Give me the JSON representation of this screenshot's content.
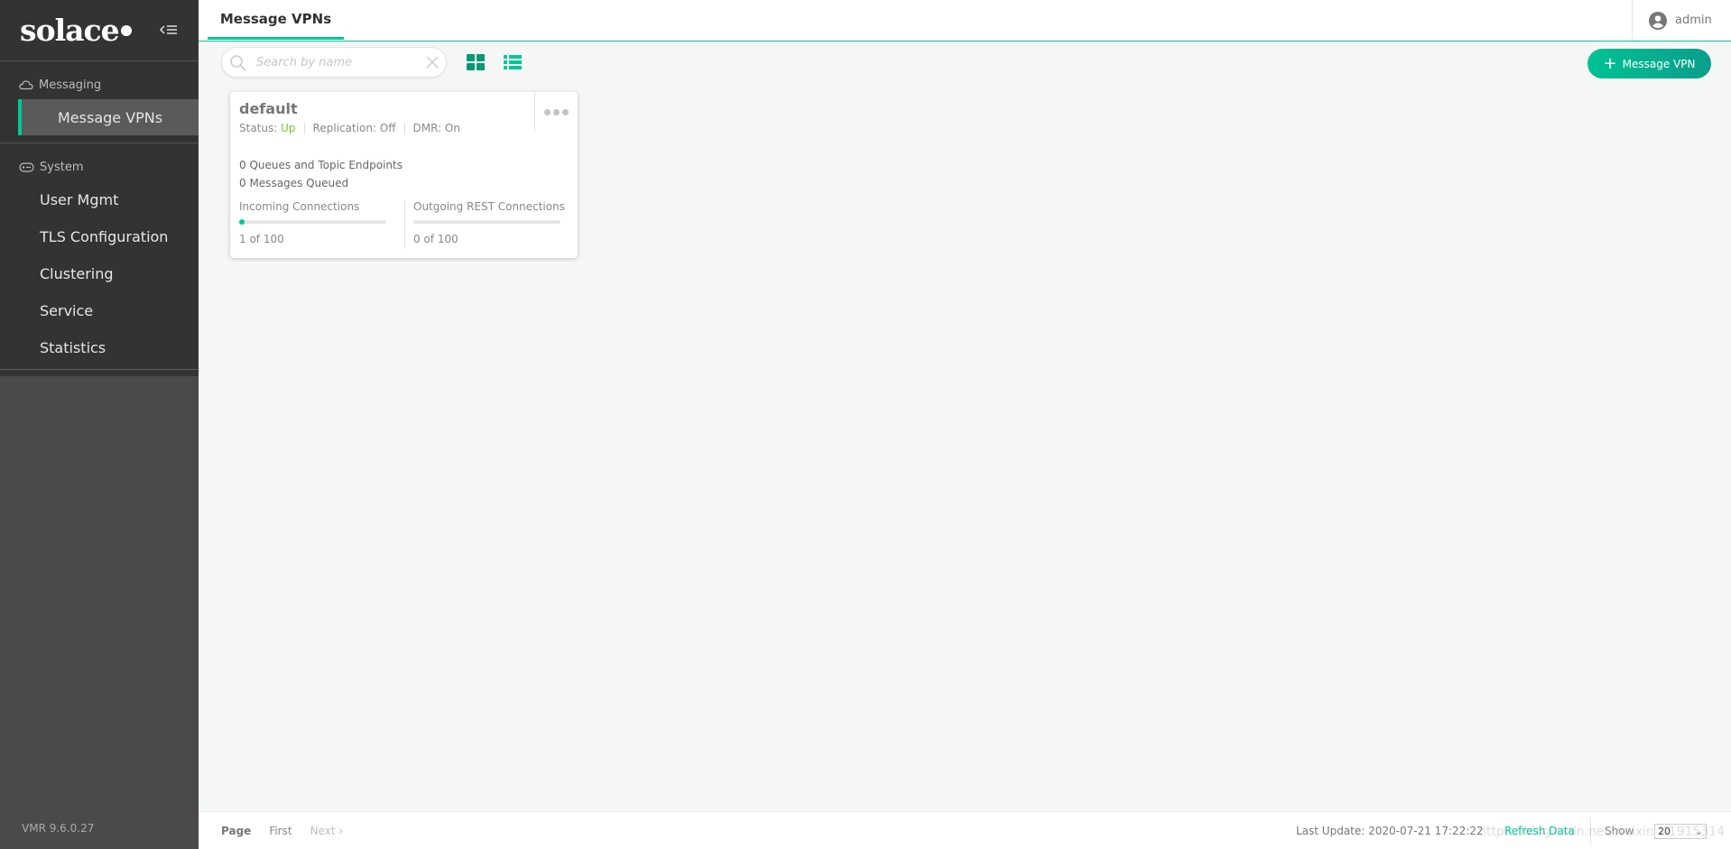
{
  "sidebar": {
    "logo": "solace",
    "sections": [
      {
        "label": "Messaging",
        "icon": "cloud-icon"
      },
      {
        "label": "System",
        "icon": "system-icon"
      }
    ],
    "messaging_items": [
      {
        "label": "Message VPNs",
        "active": true
      }
    ],
    "system_items": [
      {
        "label": "User Mgmt"
      },
      {
        "label": "TLS Configuration"
      },
      {
        "label": "Clustering"
      },
      {
        "label": "Service"
      },
      {
        "label": "Statistics"
      }
    ],
    "version": "VMR 9.6.0.27"
  },
  "header": {
    "tab": "Message VPNs",
    "user": "admin"
  },
  "toolbar": {
    "search_placeholder": "Search by name",
    "search_value": "",
    "add_button": "Message VPN",
    "view_mode": "grid"
  },
  "cards": [
    {
      "name": "default",
      "status_label": "Status:",
      "status": "Up",
      "replication": "Replication: Off",
      "dmr": "DMR: On",
      "queues": "0 Queues and Topic Endpoints",
      "messages": "0 Messages Queued",
      "incoming": {
        "label": "Incoming Connections",
        "value": "1 of 100",
        "fraction": 0.01
      },
      "outgoing": {
        "label": "Outgoing REST Connections",
        "value": "0 of 100",
        "fraction": 0
      }
    }
  ],
  "footer": {
    "page_label": "Page",
    "first": "First",
    "next": "Next",
    "last_update": "Last Update: 2020-07-21 17:22:22",
    "refresh": "Refresh Data",
    "show_label": "Show",
    "show_value": "20",
    "watermark": "https://blog.csdn.net/weixin_41915314"
  },
  "colors": {
    "accent": "#00c895",
    "status_up": "#7ec82a",
    "sidebar": "#333333"
  }
}
